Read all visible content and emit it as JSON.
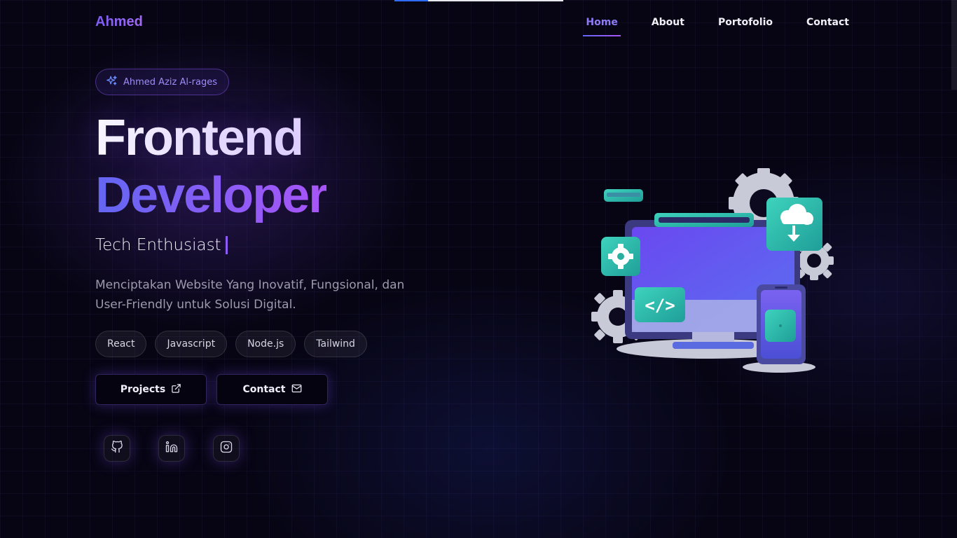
{
  "nav": {
    "logo": "Ahmed",
    "items": [
      {
        "label": "Home",
        "active": true
      },
      {
        "label": "About",
        "active": false
      },
      {
        "label": "Portofolio",
        "active": false
      },
      {
        "label": "Contact",
        "active": false
      }
    ]
  },
  "hero": {
    "badge": "Ahmed Aziz Al-rages",
    "title_line1": "Frontend",
    "title_line2": "Developer",
    "subtitle": "Tech Enthusiast",
    "description": "Menciptakan Website Yang Inovatif, Fungsional, dan User-Friendly untuk Solusi Digital.",
    "tags": [
      "React",
      "Javascript",
      "Node.js",
      "Tailwind"
    ],
    "buttons": {
      "projects_label": "Projects",
      "contact_label": "Contact"
    },
    "socials": [
      "github-icon",
      "linkedin-icon",
      "instagram-icon"
    ]
  },
  "colors": {
    "accent_purple": "#8b5cf6",
    "accent_indigo": "#6366f1",
    "background": "#070514",
    "teal": "#2ec7b0"
  }
}
